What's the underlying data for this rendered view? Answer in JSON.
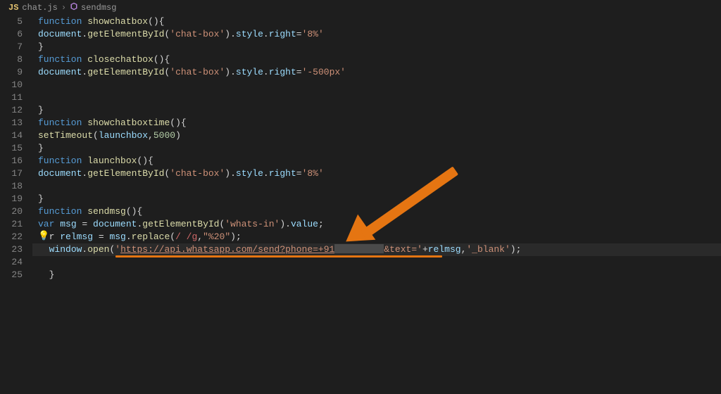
{
  "breadcrumb": {
    "file_icon": "JS",
    "file": "chat.js",
    "sep": "›",
    "symbol": "sendmsg"
  },
  "gutter": {
    "start": 5,
    "end": 25
  },
  "tokens": {
    "function": "function",
    "var": "var",
    "document": "document",
    "getElementById": "getElementById",
    "style": "style",
    "right": "right",
    "value": "value",
    "setTimeout": "setTimeout",
    "window": "window",
    "open": "open",
    "replace": "replace",
    "msg": "msg",
    "relmsg": "relmsg",
    "launchbox_ref": "launchbox"
  },
  "functions": {
    "showchatbox": "showchatbox",
    "closechatbox": "closechatbox",
    "showchatboxtime": "showchatboxtime",
    "launchbox": "launchbox",
    "sendmsg": "sendmsg"
  },
  "strings": {
    "chatbox": "'chat-box'",
    "eight": "'8%'",
    "neg500": "'-500px'",
    "whatsin": "'whats-in'",
    "pct20": "\"%20\"",
    "url_open": "'",
    "url_text": "https://api.whatsapp.com/send?phone=+91",
    "url_after": "&text='",
    "blank": "'_blank'"
  },
  "numbers": {
    "timeout": "5000"
  },
  "regex": {
    "space": "/ /g"
  },
  "braces": {
    "open_paren": "(",
    "close_paren": ")",
    "open_brace": "{",
    "close_brace": "}",
    "open_both": "(){",
    "semicolon": ";",
    "dot": ".",
    "comma": ",",
    "eq": " = ",
    "plus": "+",
    "assign": "="
  }
}
